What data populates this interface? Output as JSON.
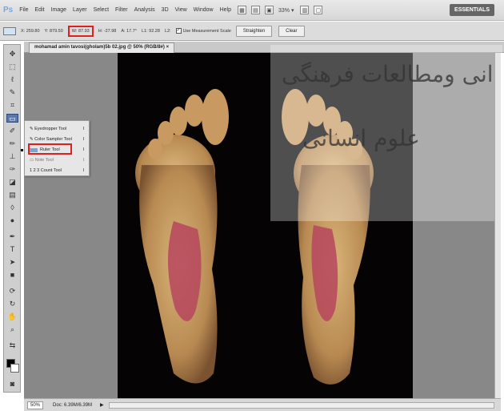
{
  "app": {
    "logo": "Ps"
  },
  "menu": {
    "items": [
      "File",
      "Edit",
      "Image",
      "Layer",
      "Select",
      "Filter",
      "Analysis",
      "3D",
      "View",
      "Window",
      "Help"
    ],
    "zoom": "33% ▾",
    "workspace": "ESSENTIALS"
  },
  "options": {
    "x": "X: 259.80",
    "y": "Y: 879.50",
    "w": "W: 87.93",
    "h": "H: -27.98",
    "a": "A: 17.7°",
    "l1": "L1: 92.28",
    "l2": "L2:",
    "use_measurement_scale": "Use Measurement Scale",
    "straighten": "Straighten",
    "clear": "Clear"
  },
  "document": {
    "tab_title": "mohamad amin tavosi(gholam)5b 02.jpg @ 50% (RGB/8#)",
    "close": "×"
  },
  "flyout": {
    "items": [
      {
        "label": "Eyedropper Tool",
        "key": "I"
      },
      {
        "label": "Color Sampler Tool",
        "key": "I"
      },
      {
        "label": "Ruler Tool",
        "key": "I"
      },
      {
        "label": "Note Tool",
        "key": "I"
      },
      {
        "label": "1 2 3 Count Tool",
        "key": "I"
      }
    ]
  },
  "watermark": {
    "line1": "انی ومطالعات فرهنگی",
    "line2": "علوم انسانی"
  },
  "status": {
    "zoom": "50%",
    "doc": "Doc: 6.39M/6.39M"
  },
  "colors": {
    "accent": "#e02020",
    "selected_tool": "#5b78a8"
  }
}
